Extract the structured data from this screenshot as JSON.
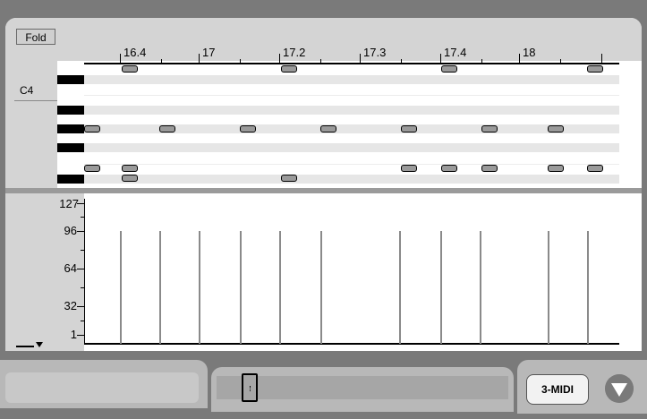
{
  "clip_view": {
    "fold_label": "Fold",
    "pitch_label": "C4",
    "ruler_labels": [
      "16.4",
      "17",
      "17.2",
      "17.3",
      "17.4",
      "18"
    ],
    "velocity_labels": [
      "127",
      "96",
      "64",
      "32",
      "1"
    ]
  },
  "bottom_bar": {
    "track_button": "3-MIDI"
  },
  "icons": {
    "velocity_menu": "triangle-down-icon",
    "expand": "circle-triangle-down-icon"
  }
}
